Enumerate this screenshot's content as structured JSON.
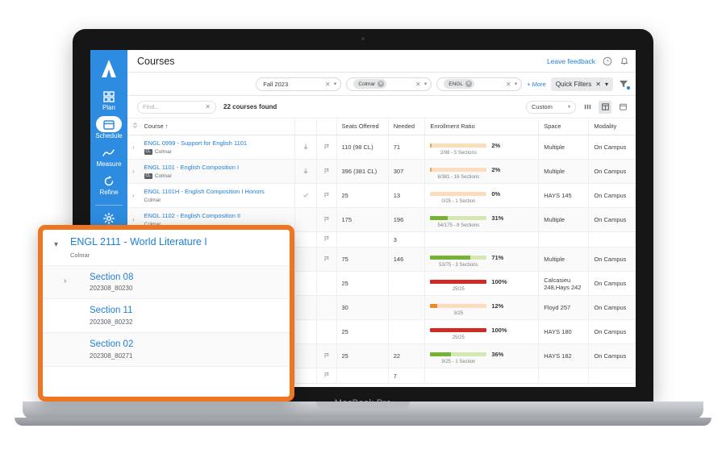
{
  "device": {
    "label": "MacBook Pro"
  },
  "app": {
    "header": {
      "title": "Courses",
      "feedback_label": "Leave feedback",
      "help_icon": "help-circle-icon",
      "notification_icon": "bell-icon"
    },
    "sidebar": {
      "logo": "abacus-logo",
      "items": [
        {
          "label": "Plan",
          "icon": "grid-icon",
          "active": false
        },
        {
          "label": "Schedule",
          "icon": "calendar-icon",
          "active": true
        },
        {
          "label": "Measure",
          "icon": "trend-icon",
          "active": false
        },
        {
          "label": "Refine",
          "icon": "refresh-icon",
          "active": false
        },
        {
          "label": "Admin",
          "icon": "gear-icon",
          "active": false
        }
      ]
    },
    "filters": {
      "term": "Fall 2023",
      "campus_chip": "Colmar",
      "subject_chip": "ENGL",
      "more_label": "+ More",
      "quick_filters_label": "Quick Filters",
      "funnel_icon": "filter-funnel-icon"
    },
    "toolbar": {
      "find_placeholder": "Find...",
      "find_value": "",
      "results_count": "22 courses found",
      "view_select": "Custom",
      "views": [
        {
          "icon": "columns-view-icon",
          "active": false
        },
        {
          "icon": "table-view-icon",
          "active": true
        },
        {
          "icon": "calendar-view-icon",
          "active": false
        }
      ]
    },
    "table": {
      "columns": [
        "Course ↑",
        "Seats Offered",
        "Needed",
        "Enrollment Ratio",
        "Space",
        "Modality"
      ],
      "rows": [
        {
          "course": "ENGL 0999 - Support for English 1101",
          "badge": "CL",
          "campus": "Colmar",
          "action_icon": "down-arrow-icon",
          "flag_icon": "flag-icon",
          "seats": "110 (98 CL)",
          "needed": "71",
          "pct": "2%",
          "pct_value": 2,
          "detail": "2/98 - 5 Sections",
          "bar_color": "#f0a04b",
          "track_color": "#fbdcbd",
          "space": "Multiple",
          "modality": "On Campus"
        },
        {
          "course": "ENGL 1101 - English Composition I",
          "badge": "CL",
          "campus": "Colmar",
          "action_icon": "down-arrow-icon",
          "flag_icon": "flag-icon",
          "seats": "396 (381 CL)",
          "needed": "307",
          "pct": "2%",
          "pct_value": 2,
          "detail": "6/381 - 16 Sections",
          "bar_color": "#f0a04b",
          "track_color": "#fbdcbd",
          "space": "Multiple",
          "modality": "On Campus"
        },
        {
          "course": "ENGL 1101H - English Composition I Honors",
          "badge": "",
          "campus": "Colmar",
          "action_icon": "check-icon",
          "flag_icon": "flag-icon",
          "seats": "25",
          "needed": "13",
          "pct": "0%",
          "pct_value": 0,
          "detail": "0/25 - 1 Section",
          "bar_color": "#f0a04b",
          "track_color": "#fbdcbd",
          "space": "HAYS 145",
          "modality": "On Campus"
        },
        {
          "course": "ENGL 1102 - English Composition II",
          "badge": "",
          "campus": "Colmar",
          "action_icon": "",
          "flag_icon": "flag-icon",
          "seats": "175",
          "needed": "196",
          "pct": "31%",
          "pct_value": 31,
          "detail": "54/175 - 8 Sections",
          "bar_color": "#77b333",
          "track_color": "#d4e8b4",
          "space": "Multiple",
          "modality": "On Campus"
        },
        {
          "course": "",
          "badge": "",
          "campus": "",
          "action_icon": "",
          "flag_icon": "flag-icon",
          "seats": "",
          "needed": "3",
          "pct": "",
          "pct_value": null,
          "detail": "",
          "bar_color": "",
          "track_color": "",
          "space": "",
          "modality": ""
        },
        {
          "course": "",
          "badge": "",
          "campus": "",
          "action_icon": "",
          "flag_icon": "flag-icon",
          "seats": "75",
          "needed": "146",
          "pct": "71%",
          "pct_value": 71,
          "detail": "53/75 - 3 Sections",
          "bar_color": "#77b333",
          "track_color": "#d4e8b4",
          "space": "Multiple",
          "modality": "On Campus"
        },
        {
          "course": "",
          "badge": "",
          "campus": "",
          "action_icon": "",
          "flag_icon": "",
          "seats": "25",
          "needed": "",
          "pct": "100%",
          "pct_value": 100,
          "detail": "25/25",
          "bar_color": "#cf2a23",
          "track_color": "#cf2a23",
          "space": "Calcasieu 248,Hays 242",
          "modality": "On Campus"
        },
        {
          "course": "",
          "badge": "",
          "campus": "",
          "action_icon": "",
          "flag_icon": "",
          "seats": "30",
          "needed": "",
          "pct": "12%",
          "pct_value": 12,
          "detail": "3/25",
          "bar_color": "#ef8b27",
          "track_color": "#fbdcbd",
          "space": "Floyd 257",
          "modality": "On Campus"
        },
        {
          "course": "",
          "badge": "",
          "campus": "",
          "action_icon": "",
          "flag_icon": "",
          "seats": "25",
          "needed": "",
          "pct": "100%",
          "pct_value": 100,
          "detail": "25/25",
          "bar_color": "#cf2a23",
          "track_color": "#cf2a23",
          "space": "HAYS 180",
          "modality": "On Campus"
        },
        {
          "course": "",
          "badge": "",
          "campus": "",
          "action_icon": "",
          "flag_icon": "flag-icon",
          "seats": "25",
          "needed": "22",
          "pct": "36%",
          "pct_value": 36,
          "detail": "9/25 - 1 Section",
          "bar_color": "#77b333",
          "track_color": "#d4e8b4",
          "space": "HAYS 182",
          "modality": "On Campus"
        },
        {
          "course": "",
          "badge": "",
          "campus": "",
          "action_icon": "",
          "flag_icon": "flag-icon",
          "seats": "",
          "needed": "7",
          "pct": "",
          "pct_value": null,
          "detail": "",
          "bar_color": "",
          "track_color": "",
          "space": "",
          "modality": ""
        }
      ]
    }
  },
  "callout": {
    "accent_color": "#ee7623",
    "course_title": "ENGL 2111 - World Literature I",
    "campus": "Colmar",
    "sections": [
      {
        "name": "Section 08",
        "id": "202308_80230",
        "has_chevron": true
      },
      {
        "name": "Section 11",
        "id": "202308_80232",
        "has_chevron": false
      },
      {
        "name": "Section 02",
        "id": "202308_80271",
        "has_chevron": false
      }
    ]
  }
}
